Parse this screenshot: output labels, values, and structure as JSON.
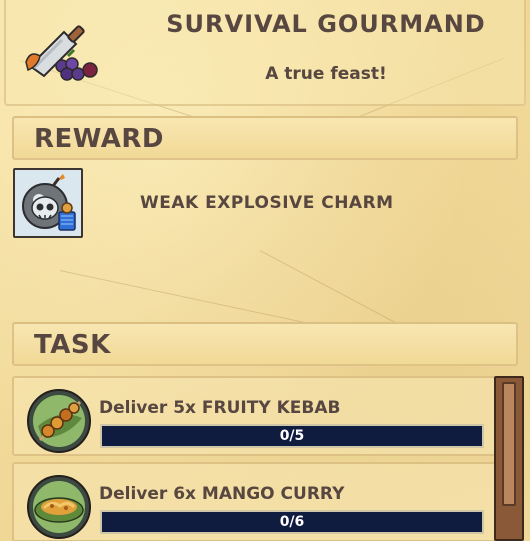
{
  "quest": {
    "title": "SURVIVAL GOURMAND",
    "subtitle": "A true feast!",
    "icon": "food-cleaver-icon"
  },
  "reward": {
    "section_label": "REWARD",
    "item_name": "WEAK EXPLOSIVE CHARM",
    "item_icon": "skull-bomb-charm-icon"
  },
  "task": {
    "section_label": "TASK",
    "items": [
      {
        "text": "Deliver 5x FRUITY KEBAB",
        "progress": "0/5",
        "current": 0,
        "total": 5,
        "icon": "fruit-kebab-icon"
      },
      {
        "text": "Deliver 6x MANGO CURRY",
        "progress": "0/6",
        "current": 0,
        "total": 6,
        "icon": "mango-curry-icon"
      }
    ]
  },
  "colors": {
    "parchment": "#f3dd9e",
    "text": "#584740",
    "progress_bg": "#101b40",
    "scrollbar": "#8a5a38"
  }
}
